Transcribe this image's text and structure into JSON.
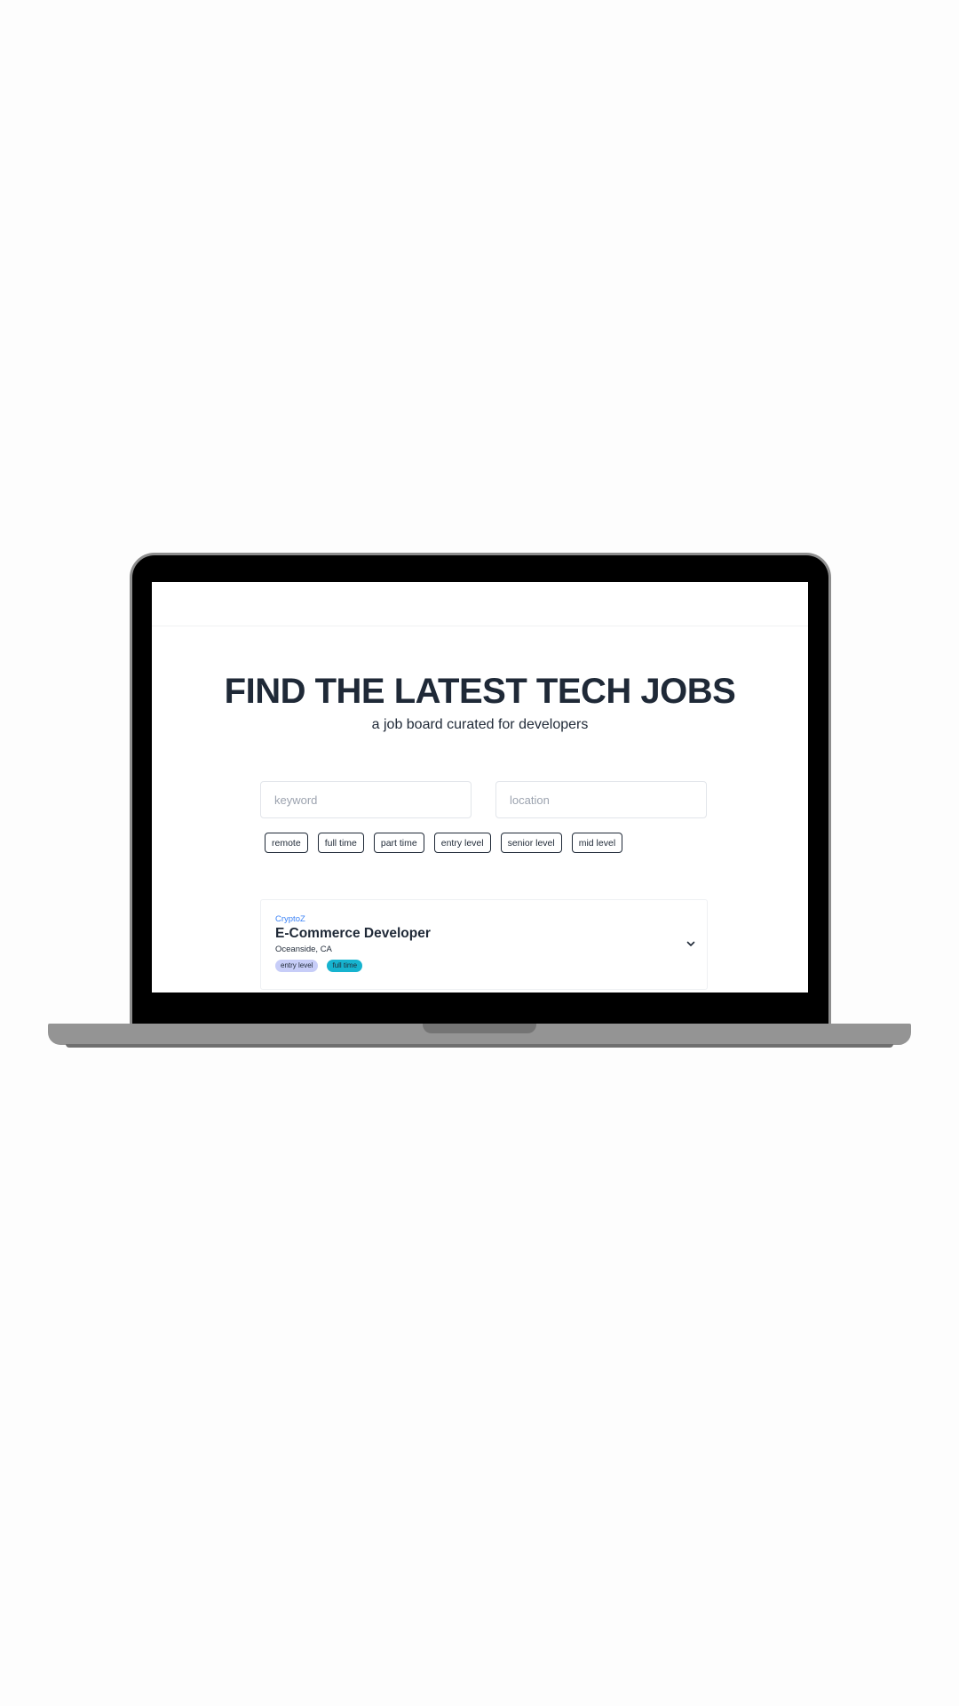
{
  "hero": {
    "title": "FIND THE LATEST TECH JOBS",
    "subtitle": "a job board curated for developers"
  },
  "search": {
    "keyword_placeholder": "keyword",
    "keyword_value": "",
    "location_placeholder": "location",
    "location_value": ""
  },
  "filters": [
    "remote",
    "full time",
    "part time",
    "entry level",
    "senior level",
    "mid level"
  ],
  "jobs": [
    {
      "company": "CryptoZ",
      "title": "E-Commerce Developer",
      "location": "Oceanside, CA",
      "tags": [
        "entry level",
        "full time"
      ]
    }
  ],
  "icons": {
    "expand": "chevron-down-icon"
  },
  "colors": {
    "heading": "#1f2937",
    "company_link": "#3b82f6",
    "tag_level": "#c7cdf8",
    "tag_type": "#16b3cf"
  }
}
